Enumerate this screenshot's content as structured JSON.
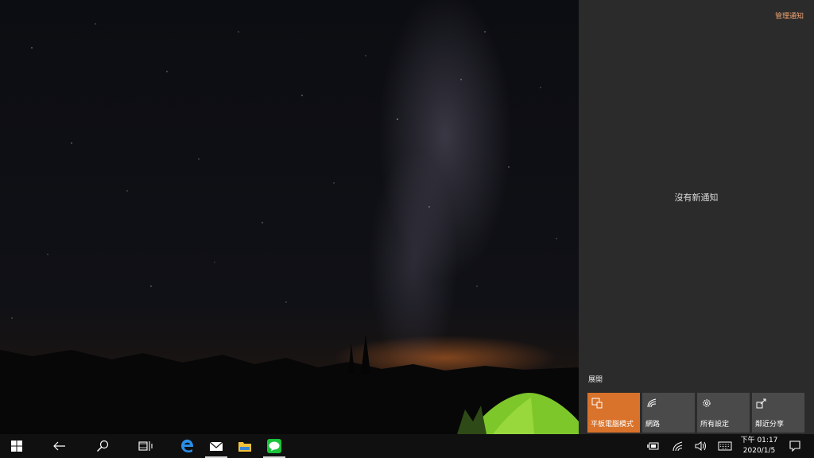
{
  "desktop": {
    "wallpaper": "night sky with milky way, mountains and green tent"
  },
  "action_center": {
    "manage_label": "管理通知",
    "empty_message": "沒有新通知",
    "expand_label": "展開",
    "tiles": [
      {
        "label": "平板電腦模式",
        "icon": "tablet-mode-icon",
        "active": true
      },
      {
        "label": "網路",
        "icon": "network-icon",
        "active": false
      },
      {
        "label": "所有設定",
        "icon": "settings-gear-icon",
        "active": false
      },
      {
        "label": "鄰近分享",
        "icon": "nearby-share-icon",
        "active": false
      }
    ],
    "accent_color": "#d9722a"
  },
  "taskbar": {
    "time": "下午 01:17",
    "date": "2020/1/5",
    "pinned": [
      "edge",
      "mail",
      "file-explorer",
      "line"
    ]
  }
}
